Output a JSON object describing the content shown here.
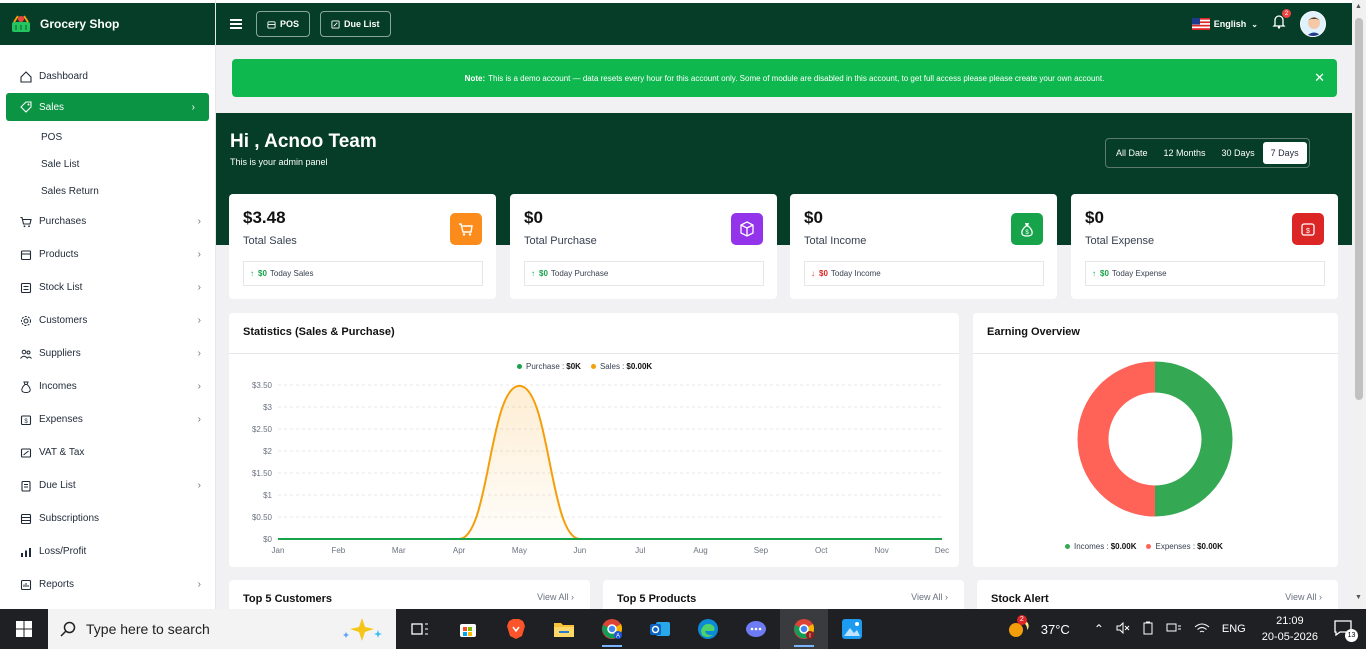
{
  "brand": {
    "name": "Grocery Shop"
  },
  "sidebar": {
    "items": [
      {
        "label": "Dashboard",
        "icon": "home-icon",
        "chevron": false
      },
      {
        "label": "Sales",
        "icon": "tag-icon",
        "chevron": true,
        "active": true
      },
      {
        "label": "Purchases",
        "icon": "cart-icon",
        "chevron": true
      },
      {
        "label": "Products",
        "icon": "box-icon",
        "chevron": true
      },
      {
        "label": "Stock List",
        "icon": "list-icon",
        "chevron": true
      },
      {
        "label": "Customers",
        "icon": "users-icon",
        "chevron": true
      },
      {
        "label": "Suppliers",
        "icon": "supplier-icon",
        "chevron": true
      },
      {
        "label": "Incomes",
        "icon": "income-icon",
        "chevron": true
      },
      {
        "label": "Expenses",
        "icon": "expense-icon",
        "chevron": true
      },
      {
        "label": "VAT & Tax",
        "icon": "tax-icon",
        "chevron": false
      },
      {
        "label": "Due List",
        "icon": "due-icon",
        "chevron": true
      },
      {
        "label": "Subscriptions",
        "icon": "subscription-icon",
        "chevron": false
      },
      {
        "label": "Loss/Profit",
        "icon": "chart-icon",
        "chevron": false
      },
      {
        "label": "Reports",
        "icon": "report-icon",
        "chevron": true
      }
    ],
    "sales_sub": [
      "POS",
      "Sale List",
      "Sales Return"
    ]
  },
  "topbar": {
    "pos_label": "POS",
    "due_label": "Due List",
    "language": "English",
    "notif_count": "2"
  },
  "notice": {
    "bold": "Note:",
    "text": "This is a demo account — data resets every hour for this account only. Some of module are disabled in this account, to get full access please please create your own account.",
    "close": "✕"
  },
  "greeting": {
    "title": "Hi , Acnoo Team",
    "subtitle": "This is your admin panel"
  },
  "ranges": [
    "All Date",
    "12 Months",
    "30 Days",
    "7 Days"
  ],
  "stats": [
    {
      "value": "$3.48",
      "label": "Total Sales",
      "foot_amount": "$0",
      "foot_label": "Today Sales",
      "trend": "up",
      "color": "#fb8c1c",
      "icon": "cart-icon"
    },
    {
      "value": "$0",
      "label": "Total Purchase",
      "foot_amount": "$0",
      "foot_label": "Today Purchase",
      "trend": "up",
      "color": "#9333ea",
      "icon": "box-icon"
    },
    {
      "value": "$0",
      "label": "Total Income",
      "foot_amount": "$0",
      "foot_label": "Today Income",
      "trend": "down",
      "color": "#16a34a",
      "icon": "money-bag-icon"
    },
    {
      "value": "$0",
      "label": "Total Expense",
      "foot_amount": "$0",
      "foot_label": "Today Expense",
      "trend": "up",
      "color": "#dc2626",
      "icon": "expense-icon"
    }
  ],
  "stats_card": {
    "title": "Statistics (Sales & Purchase)"
  },
  "earning_card": {
    "title": "Earning Overview"
  },
  "chart_data": [
    {
      "type": "line",
      "title": "Statistics (Sales & Purchase)",
      "x": [
        "Jan",
        "Feb",
        "Mar",
        "Apr",
        "May",
        "Jun",
        "Jul",
        "Aug",
        "Sep",
        "Oct",
        "Nov",
        "Dec"
      ],
      "yticks": [
        "$3.50",
        "$3",
        "$2.50",
        "$2",
        "$1.50",
        "$1",
        "$0.50",
        "$0"
      ],
      "ylim": [
        0,
        3.5
      ],
      "legend": [
        {
          "name": "Purchase",
          "value": "$0K",
          "color": "#16a34a"
        },
        {
          "name": "Sales",
          "value": "$0.00K",
          "color": "#f59e0b"
        }
      ],
      "series": [
        {
          "name": "Purchase",
          "values": [
            0,
            0,
            0,
            0,
            0,
            0,
            0,
            0,
            0,
            0,
            0,
            0
          ]
        },
        {
          "name": "Sales",
          "values": [
            0,
            0,
            0,
            0,
            3.48,
            0,
            0,
            0,
            0,
            0,
            0,
            0
          ]
        }
      ]
    },
    {
      "type": "pie",
      "title": "Earning Overview",
      "legend": [
        {
          "name": "Incomes",
          "value": "$0.00K",
          "color": "#34a853"
        },
        {
          "name": "Expenses",
          "value": "$0.00K",
          "color": "#ff6257"
        }
      ],
      "values": [
        50,
        50
      ]
    }
  ],
  "bottom_cards": [
    {
      "title": "Top 5 Customers",
      "link": "View All"
    },
    {
      "title": "Top 5 Products",
      "link": "View All"
    },
    {
      "title": "Stock Alert",
      "link": "View All"
    }
  ],
  "taskbar": {
    "search_placeholder": "Type here to search",
    "temperature": "37°C",
    "lang": "ENG",
    "time": "21:09",
    "date": "20-05-2026",
    "notifications": "13",
    "weather_badge": "2"
  }
}
